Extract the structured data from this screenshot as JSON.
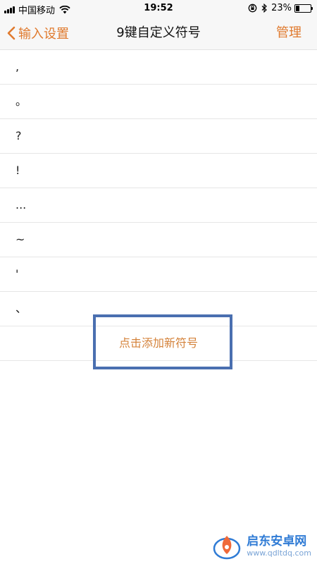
{
  "status_bar": {
    "carrier": "中国移动",
    "time": "19:52",
    "battery": "23%",
    "battery_level": 0.23,
    "icons": [
      "signal-icon",
      "wifi-icon",
      "orientation-lock-icon",
      "bluetooth-icon",
      "battery-icon"
    ]
  },
  "nav": {
    "back_label": "输入设置",
    "title": "9键自定义符号",
    "manage_label": "管理"
  },
  "symbols": [
    ",",
    "。",
    "?",
    "!",
    "...",
    "~",
    "'",
    "、"
  ],
  "add_label": "点击添加新符号",
  "colors": {
    "accent": "#e07a2e",
    "highlight": "#4a6fb0"
  },
  "watermark": {
    "title": "启东安卓网",
    "url": "www.qdltdq.com"
  }
}
